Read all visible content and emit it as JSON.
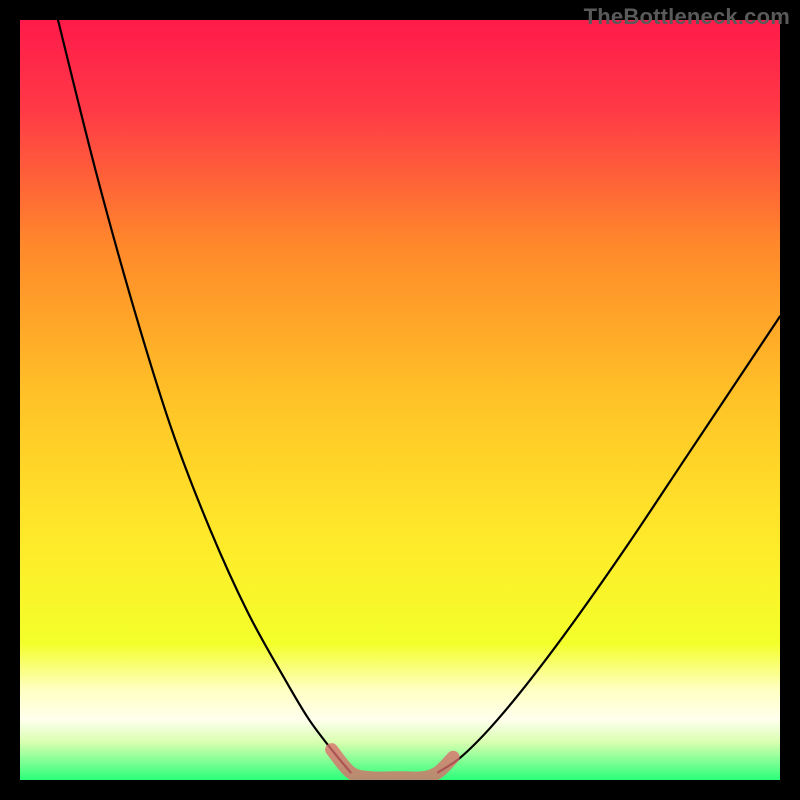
{
  "watermark": "TheBottleneck.com",
  "chart_data": {
    "type": "line",
    "title": "",
    "xlabel": "",
    "ylabel": "",
    "xlim": [
      0,
      100
    ],
    "ylim": [
      0,
      100
    ],
    "gradient_colors": {
      "top": "#ff1a4a",
      "upper_mid": "#ff8a2a",
      "mid": "#ffe92a",
      "lower_mid": "#e7ff2a",
      "band": "#ffffbb",
      "bottom": "#2bff7a"
    },
    "series": [
      {
        "name": "curve-left",
        "color": "#000000",
        "x": [
          5,
          10,
          15,
          20,
          25,
          30,
          35,
          38,
          41,
          43.5
        ],
        "y": [
          100,
          80,
          62,
          46,
          33,
          22,
          13,
          8,
          4,
          1
        ]
      },
      {
        "name": "curve-right",
        "color": "#000000",
        "x": [
          55,
          58,
          62,
          67,
          73,
          80,
          88,
          96,
          100
        ],
        "y": [
          1,
          3,
          7,
          13,
          21,
          31,
          43,
          55,
          61
        ]
      },
      {
        "name": "flat-highlight",
        "color": "#dd6b6b",
        "x": [
          41,
          43.5,
          46,
          50,
          53,
          55,
          57
        ],
        "y": [
          4,
          1,
          0.3,
          0.3,
          0.3,
          1,
          3
        ]
      }
    ]
  }
}
